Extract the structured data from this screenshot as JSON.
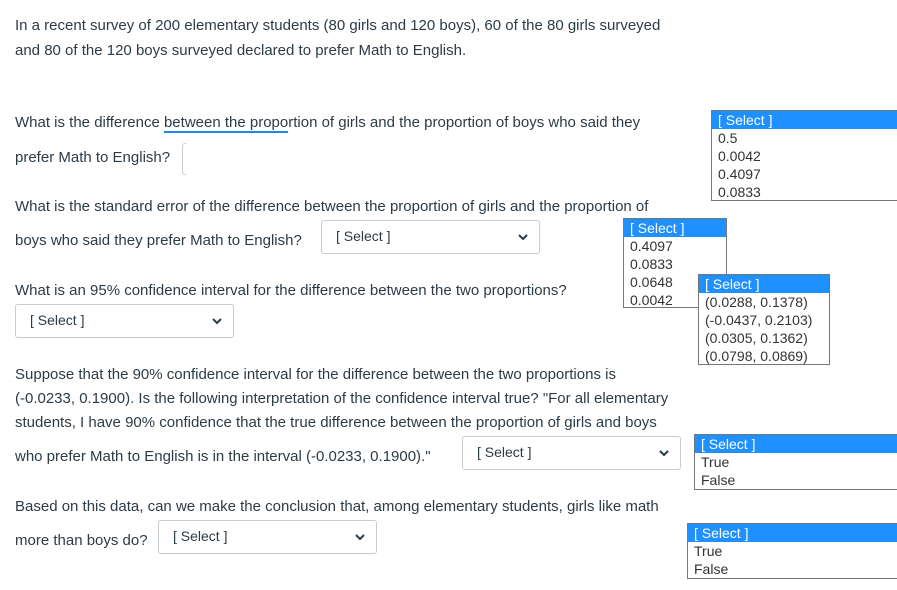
{
  "intro": {
    "line1": "In a recent survey of 200 elementary students (80 girls and 120 boys),  60 of the 80 girls surveyed",
    "line2": "and 80 of the 120 boys surveyed declared to prefer Math to English."
  },
  "q1": {
    "line1_pre": "What is the difference ",
    "line1_underlined": "between the propo",
    "line1_post": "rtion of girls and the proportion of boys who said they",
    "line2": "prefer Math to English?",
    "dropdown": {
      "options": [
        "[ Select ]",
        "0.5",
        "0.0042",
        "0.4097",
        "0.0833"
      ],
      "highlighted": "[ Select ]"
    }
  },
  "q2": {
    "line1": "What is the standard error of the difference between the proportion of girls and the proportion of",
    "line2": "boys who said they prefer Math to English?",
    "select_value": "[ Select ]",
    "dropdown": {
      "options": [
        "[ Select ]",
        "0.4097",
        "0.0833",
        "0.0648",
        "0.0042"
      ],
      "highlighted": "[ Select ]"
    }
  },
  "q3": {
    "line1": "What is an 95% confidence interval for the difference between the two proportions?",
    "select_value": "[ Select ]",
    "dropdown": {
      "options": [
        "[ Select ]",
        "(0.0288, 0.1378)",
        "(-0.0437, 0.2103)",
        "(0.0305, 0.1362)",
        "(0.0798, 0.0869)"
      ],
      "highlighted": "[ Select ]"
    }
  },
  "q4": {
    "line1": "Suppose that the 90% confidence interval for the difference between the two proportions is",
    "line2": "(-0.0233, 0.1900). Is the following interpretation of the confidence interval true? \"For all elementary",
    "line3": "students, I have 90% confidence that the true difference between the proportion of girls and boys",
    "line4": "who prefer Math to English is in the interval (-0.0233, 0.1900).\"",
    "select_value": "[ Select ]",
    "dropdown": {
      "options": [
        "[ Select ]",
        "True",
        "False"
      ],
      "highlighted": "[ Select ]"
    }
  },
  "q5": {
    "line1": "Based on this data, can we make the conclusion that, among elementary students, girls like math",
    "line2": "more than boys do?",
    "select_value": "[ Select ]",
    "dropdown": {
      "options": [
        "[ Select ]",
        "True",
        "False"
      ],
      "highlighted": "[ Select ]"
    }
  },
  "icons": {
    "select_chevron": "chevron-down-icon"
  },
  "colors": {
    "highlight": "#1e90ff",
    "underline": "#1e88e5",
    "text": "#2d3b45"
  }
}
